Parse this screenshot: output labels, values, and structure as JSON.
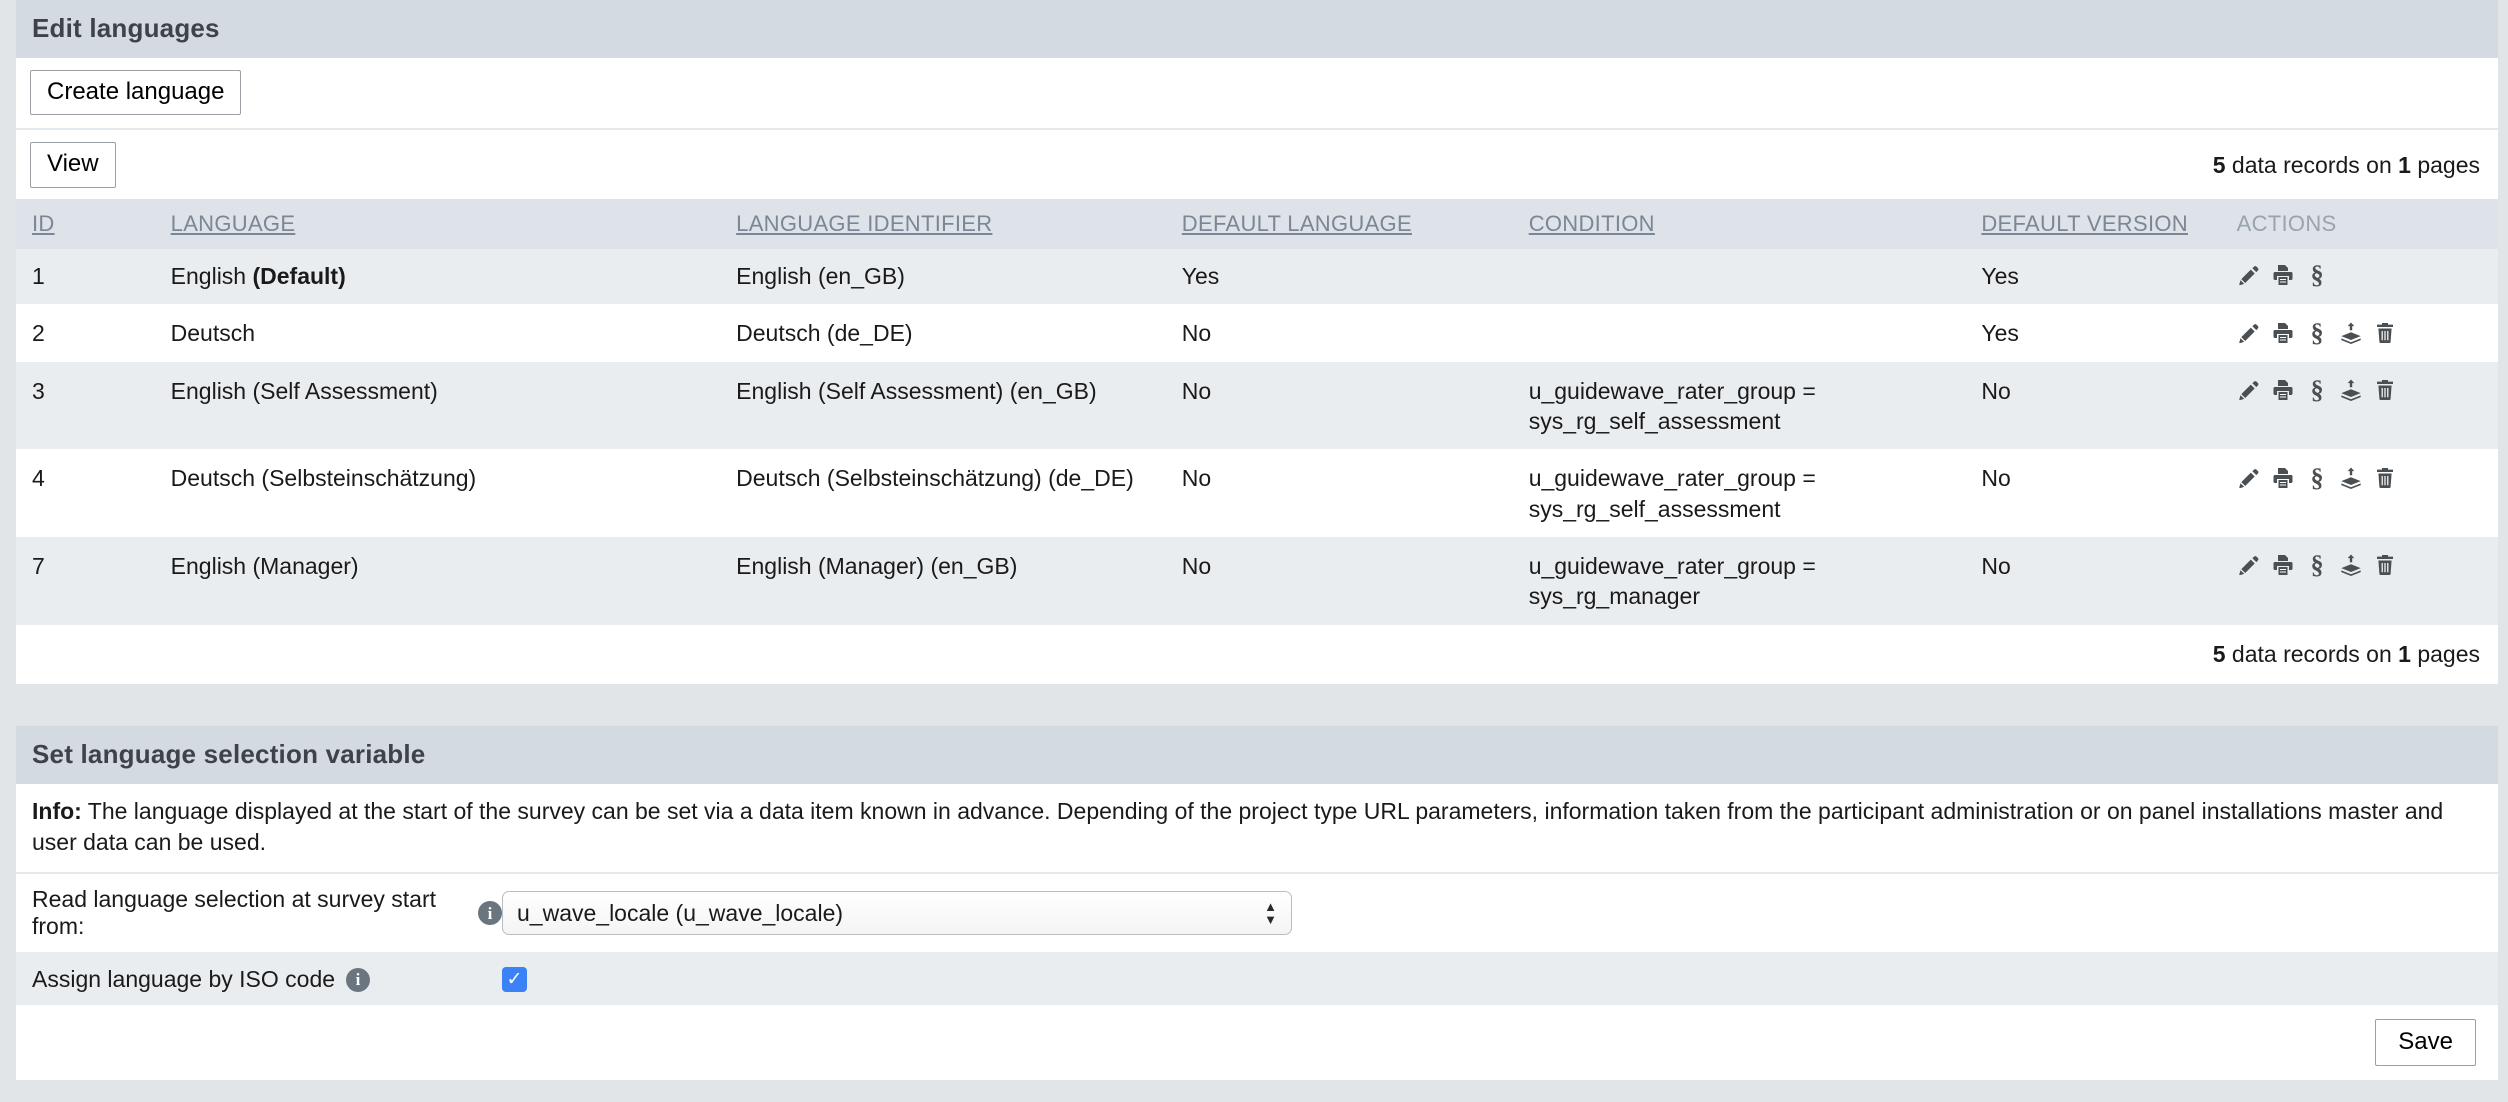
{
  "top_panel": {
    "title": "Edit languages",
    "create_button": "Create language",
    "view_button": "View",
    "records_prefix_count": "5",
    "records_mid": " data records on ",
    "records_pages": "1",
    "records_suffix": " pages"
  },
  "table": {
    "headers": {
      "id": "ID",
      "language": "LANGUAGE",
      "identifier": "LANGUAGE IDENTIFIER",
      "default_language": "DEFAULT LANGUAGE",
      "condition": "CONDITION",
      "default_version": "DEFAULT VERSION",
      "actions": "ACTIONS"
    },
    "rows": [
      {
        "id": "1",
        "language": "English ",
        "language_bold": "(Default)",
        "identifier": "English (en_GB)",
        "default_language": "Yes",
        "condition": "",
        "default_version": "Yes",
        "actions": [
          "edit-icon",
          "print-icon",
          "section-icon"
        ]
      },
      {
        "id": "2",
        "language": "Deutsch",
        "language_bold": "",
        "identifier": "Deutsch (de_DE)",
        "default_language": "No",
        "condition": "",
        "default_version": "Yes",
        "actions": [
          "edit-icon",
          "print-icon",
          "section-icon",
          "export-icon",
          "delete-icon"
        ]
      },
      {
        "id": "3",
        "language": "English (Self Assessment)",
        "language_bold": "",
        "identifier": "English (Self Assessment) (en_GB)",
        "default_language": "No",
        "condition": "u_guidewave_rater_group = sys_rg_self_assessment",
        "default_version": "No",
        "actions": [
          "edit-icon",
          "print-icon",
          "section-icon",
          "export-icon",
          "delete-icon"
        ]
      },
      {
        "id": "4",
        "language": "Deutsch (Selbsteinschätzung)",
        "language_bold": "",
        "identifier": "Deutsch (Selbsteinschätzung) (de_DE)",
        "default_language": "No",
        "condition": "u_guidewave_rater_group = sys_rg_self_assessment",
        "default_version": "No",
        "actions": [
          "edit-icon",
          "print-icon",
          "section-icon",
          "export-icon",
          "delete-icon"
        ]
      },
      {
        "id": "7",
        "language": "English (Manager)",
        "language_bold": "",
        "identifier": "English (Manager) (en_GB)",
        "default_language": "No",
        "condition": "u_guidewave_rater_group = sys_rg_manager",
        "default_version": "No",
        "actions": [
          "edit-icon",
          "print-icon",
          "section-icon",
          "export-icon",
          "delete-icon"
        ]
      }
    ]
  },
  "bottom_panel": {
    "title": "Set language selection variable",
    "info_label": "Info:",
    "info_text": " The language displayed at the start of the survey can be set via a data item known in advance. Depending of the project type URL parameters, information taken from the participant administration or on panel installations master and user data can be used.",
    "read_language_label": "Read language selection at survey start from:",
    "read_language_value": "u_wave_locale (u_wave_locale)",
    "assign_iso_label": "Assign language by ISO code",
    "assign_iso_checked": "✓",
    "save_button": "Save"
  },
  "colors": {
    "panel_header_bg": "#d3dae1",
    "table_header_bg": "#dde3e8",
    "row_shaded_bg": "#e9edf0",
    "page_bg": "#e2e5e8",
    "checkbox_blue": "#3b82f6",
    "sort_link": "#7b8794"
  }
}
